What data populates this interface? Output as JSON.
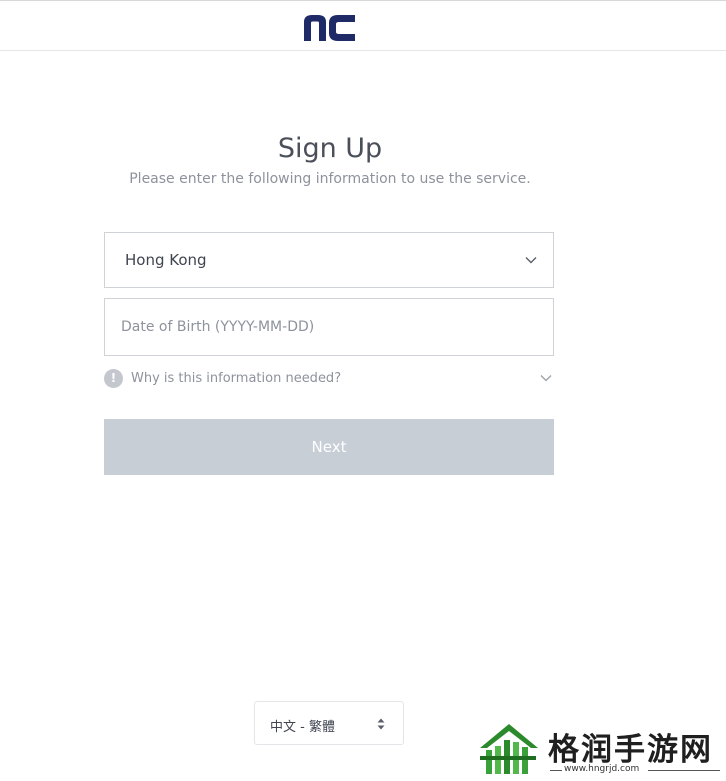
{
  "header": {
    "logo_icon": "nc-logo"
  },
  "main": {
    "title": "Sign Up",
    "subtitle": "Please enter the following information to use the service.",
    "country_select": {
      "value": "Hong Kong",
      "icon": "chevron-down-icon"
    },
    "dob_input": {
      "value": "",
      "placeholder": "Date of Birth (YYYY-MM-DD)"
    },
    "info_toggle": {
      "label": "Why is this information needed?",
      "icon": "exclamation-icon",
      "glyph": "!"
    },
    "next_button": {
      "label": "Next"
    }
  },
  "footer": {
    "language_select": {
      "value": "中文 - 繁體",
      "icon": "sort-updown-icon"
    }
  },
  "watermark": {
    "text": "格润手游网",
    "url": "www.hngrjd.com"
  },
  "colors": {
    "button_disabled": "#c7ced6",
    "logo": "#1e2b66",
    "border": "#cfd2d7",
    "muted_text": "#8d929c"
  }
}
